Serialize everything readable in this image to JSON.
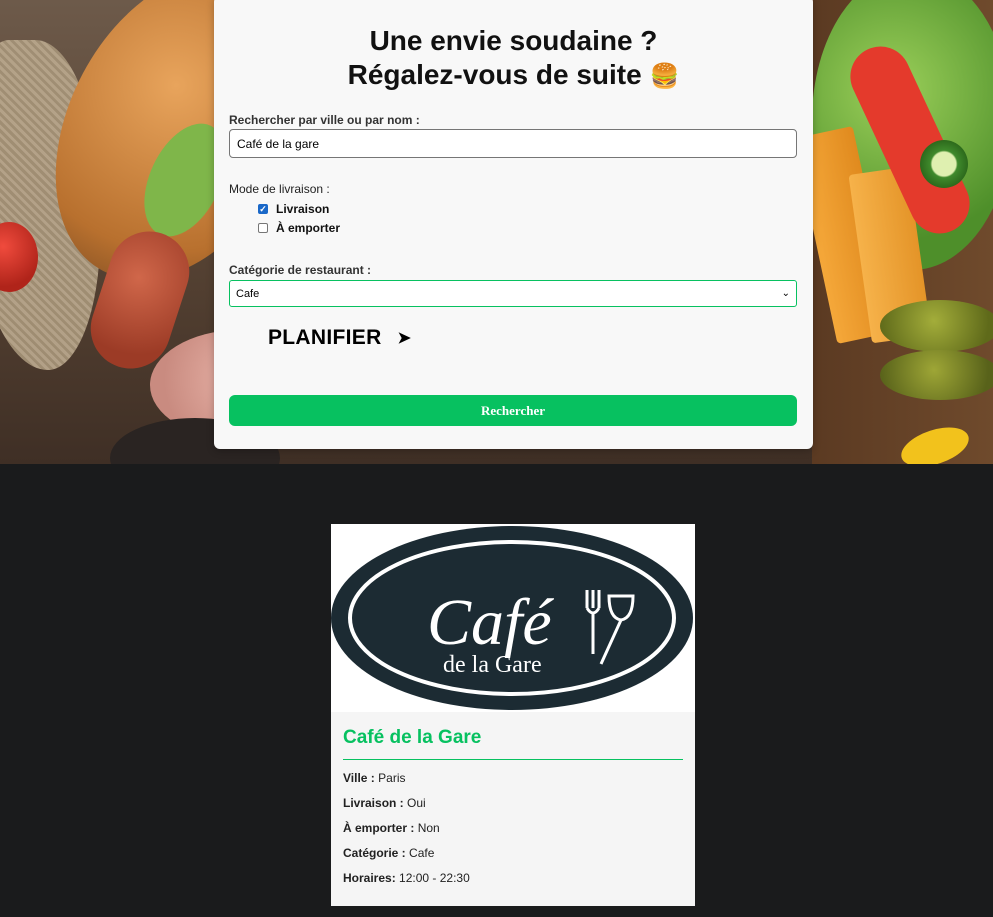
{
  "search_card": {
    "title_line1": "Une envie soudaine ?",
    "title_line2": "Régalez-vous de suite",
    "title_emoji": "🍔",
    "search_label": "Rechercher par ville ou par nom :",
    "search_value": "Café de la gare",
    "delivery_mode_label": "Mode de livraison :",
    "options": [
      {
        "label": "Livraison",
        "checked": true
      },
      {
        "label": "À emporter",
        "checked": false
      }
    ],
    "category_label": "Catégorie de restaurant :",
    "category_selected": "Cafe",
    "plan_label": "PLANIFIER",
    "plan_arrow": "➤",
    "search_button": "Rechercher"
  },
  "result": {
    "logo": {
      "word1": "Café",
      "word2": "de la Gare",
      "colors": {
        "oval": "#1c2b33",
        "text": "#ffffff"
      }
    },
    "name": "Café de la Gare",
    "fields": [
      {
        "label": "Ville :",
        "value": "Paris"
      },
      {
        "label": "Livraison :",
        "value": "Oui"
      },
      {
        "label": "À emporter :",
        "value": "Non"
      },
      {
        "label": "Catégorie :",
        "value": "Cafe"
      },
      {
        "label": "Horaires:",
        "value": "12:00 - 22:30"
      }
    ]
  },
  "colors": {
    "accent": "#07c160",
    "page_bg": "#1a1b1c",
    "card_bg": "#f8f8f8"
  }
}
